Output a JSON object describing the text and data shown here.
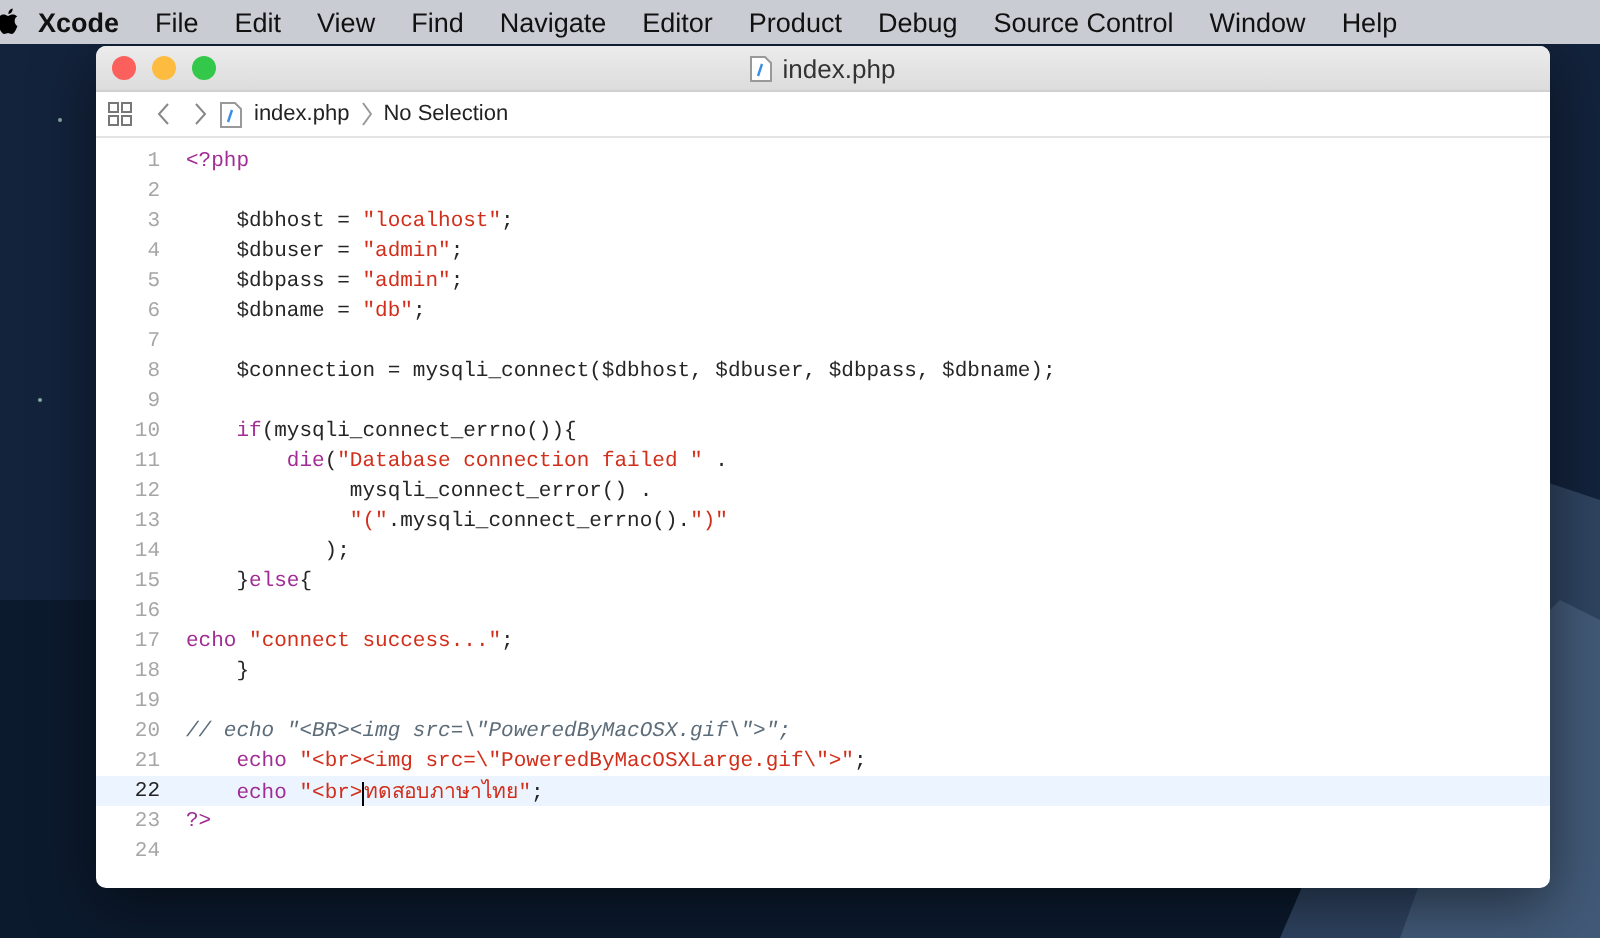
{
  "menu_bar": {
    "app": "Xcode",
    "items": [
      "File",
      "Edit",
      "View",
      "Find",
      "Navigate",
      "Editor",
      "Product",
      "Debug",
      "Source Control",
      "Window",
      "Help"
    ]
  },
  "window": {
    "title": "index.php"
  },
  "jump_bar": {
    "file": "index.php",
    "selection": "No Selection"
  },
  "editor": {
    "lines": [
      {
        "number": "1",
        "current": false,
        "tokens": [
          {
            "kind": "keyword",
            "text": "<?php"
          }
        ]
      },
      {
        "number": "2",
        "current": false
      },
      {
        "number": "3",
        "current": false,
        "tokens": [
          {
            "kind": "plain",
            "text": "    $dbhost = "
          },
          {
            "kind": "string",
            "text": "\"localhost\""
          },
          {
            "kind": "plain",
            "text": ";"
          }
        ]
      },
      {
        "number": "4",
        "current": false,
        "tokens": [
          {
            "kind": "plain",
            "text": "    $dbuser = "
          },
          {
            "kind": "string",
            "text": "\"admin\""
          },
          {
            "kind": "plain",
            "text": ";"
          }
        ]
      },
      {
        "number": "5",
        "current": false,
        "tokens": [
          {
            "kind": "plain",
            "text": "    $dbpass = "
          },
          {
            "kind": "string",
            "text": "\"admin\""
          },
          {
            "kind": "plain",
            "text": ";"
          }
        ]
      },
      {
        "number": "6",
        "current": false,
        "tokens": [
          {
            "kind": "plain",
            "text": "    $dbname = "
          },
          {
            "kind": "string",
            "text": "\"db\""
          },
          {
            "kind": "plain",
            "text": ";"
          }
        ]
      },
      {
        "number": "7",
        "current": false
      },
      {
        "number": "8",
        "current": false,
        "tokens": [
          {
            "kind": "plain",
            "text": "    $connection = mysqli_connect($dbhost, $dbuser, $dbpass, $dbname);"
          }
        ]
      },
      {
        "number": "9",
        "current": false
      },
      {
        "number": "10",
        "current": false,
        "tokens": [
          {
            "kind": "keyword",
            "text": "    if"
          },
          {
            "kind": "plain",
            "text": "(mysqli_connect_errno()){"
          }
        ]
      },
      {
        "number": "11",
        "current": false,
        "tokens": [
          {
            "kind": "keyword",
            "text": "        die"
          },
          {
            "kind": "plain",
            "text": "("
          },
          {
            "kind": "string",
            "text": "\"Database connection failed \""
          },
          {
            "kind": "plain",
            "text": " ."
          }
        ]
      },
      {
        "number": "12",
        "current": false,
        "tokens": [
          {
            "kind": "plain",
            "text": "             mysqli_connect_error() ."
          }
        ]
      },
      {
        "number": "13",
        "current": false,
        "tokens": [
          {
            "kind": "string",
            "text": "             \"(\""
          },
          {
            "kind": "plain",
            "text": ".mysqli_connect_errno()."
          },
          {
            "kind": "string",
            "text": "\")\""
          }
        ]
      },
      {
        "number": "14",
        "current": false,
        "tokens": [
          {
            "kind": "plain",
            "text": "           );"
          }
        ]
      },
      {
        "number": "15",
        "current": false,
        "tokens": [
          {
            "kind": "plain",
            "text": "    }"
          },
          {
            "kind": "keyword",
            "text": "else"
          },
          {
            "kind": "plain",
            "text": "{"
          }
        ]
      },
      {
        "number": "16",
        "current": false
      },
      {
        "number": "17",
        "current": false,
        "tokens": [
          {
            "kind": "keyword",
            "text": "echo"
          },
          {
            "kind": "string",
            "text": " \"connect success...\""
          },
          {
            "kind": "plain",
            "text": ";"
          }
        ]
      },
      {
        "number": "18",
        "current": false,
        "tokens": [
          {
            "kind": "plain",
            "text": "    }"
          }
        ]
      },
      {
        "number": "19",
        "current": false
      },
      {
        "number": "20",
        "current": false,
        "tokens": [
          {
            "kind": "comment",
            "text": "// echo \"<BR><img src=\\\"PoweredByMacOSX.gif\\\">\";"
          }
        ]
      },
      {
        "number": "21",
        "current": false,
        "tokens": [
          {
            "kind": "keyword",
            "text": "    echo"
          },
          {
            "kind": "string",
            "text": " \"<br><img src=\\\"PoweredByMacOSXLarge.gif\\\">\""
          },
          {
            "kind": "plain",
            "text": ";"
          }
        ]
      },
      {
        "number": "22",
        "current": true,
        "tokens": [
          {
            "kind": "keyword",
            "text": "    echo"
          },
          {
            "kind": "string",
            "text": " \"<br>"
          },
          {
            "kind": "string",
            "caret": true,
            "text": "ทดสอบภาษาไทย\""
          },
          {
            "kind": "plain",
            "text": ";"
          }
        ]
      },
      {
        "number": "23",
        "current": false,
        "tokens": [
          {
            "kind": "keyword",
            "text": "?>"
          }
        ]
      },
      {
        "number": "24",
        "current": false
      }
    ]
  }
}
